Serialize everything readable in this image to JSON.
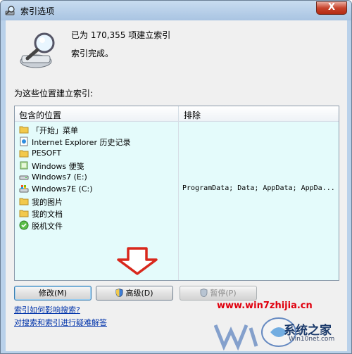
{
  "window": {
    "title": "索引选项",
    "close_glyph": "X"
  },
  "status": {
    "indexed_line": "已为 170,355 项建立索引",
    "complete_line": "索引完成。"
  },
  "section_label": "为这些位置建立索引:",
  "list": {
    "headers": {
      "location": "包含的位置",
      "exclude": "排除"
    },
    "rows": [
      {
        "icon": "folder-icon",
        "name": "「开始」菜单",
        "exclude": ""
      },
      {
        "icon": "ie-history-icon",
        "name": "Internet Explorer 历史记录",
        "exclude": ""
      },
      {
        "icon": "folder-icon",
        "name": "PESOFT",
        "exclude": ""
      },
      {
        "icon": "notes-icon",
        "name": "Windows 便笺",
        "exclude": ""
      },
      {
        "icon": "drive-icon",
        "name": "Windows7 (E:)",
        "exclude": ""
      },
      {
        "icon": "system-drive-icon",
        "name": "Windows7E (C:)",
        "exclude": "ProgramData; Data; AppData; AppDa..."
      },
      {
        "icon": "folder-icon",
        "name": "我的图片",
        "exclude": ""
      },
      {
        "icon": "folder-icon",
        "name": "我的文档",
        "exclude": ""
      },
      {
        "icon": "offline-files-icon",
        "name": "脱机文件",
        "exclude": ""
      }
    ]
  },
  "buttons": {
    "modify": "修改(M)",
    "advanced": "高级(D)",
    "pause": "暂停(P)"
  },
  "links": {
    "how_affects": "索引如何影响搜索?",
    "troubleshoot": "对搜索和索引进行疑难解答"
  },
  "watermark": {
    "url": "www.win7zhijia.cn",
    "brand": "系统之家",
    "site": "Win10net.com"
  },
  "colors": {
    "list_bg": "#e4fbfb",
    "link": "#0033aa",
    "close": "#c7432c",
    "arrow": "#d8281c",
    "watermark_red": "#e0000e"
  }
}
